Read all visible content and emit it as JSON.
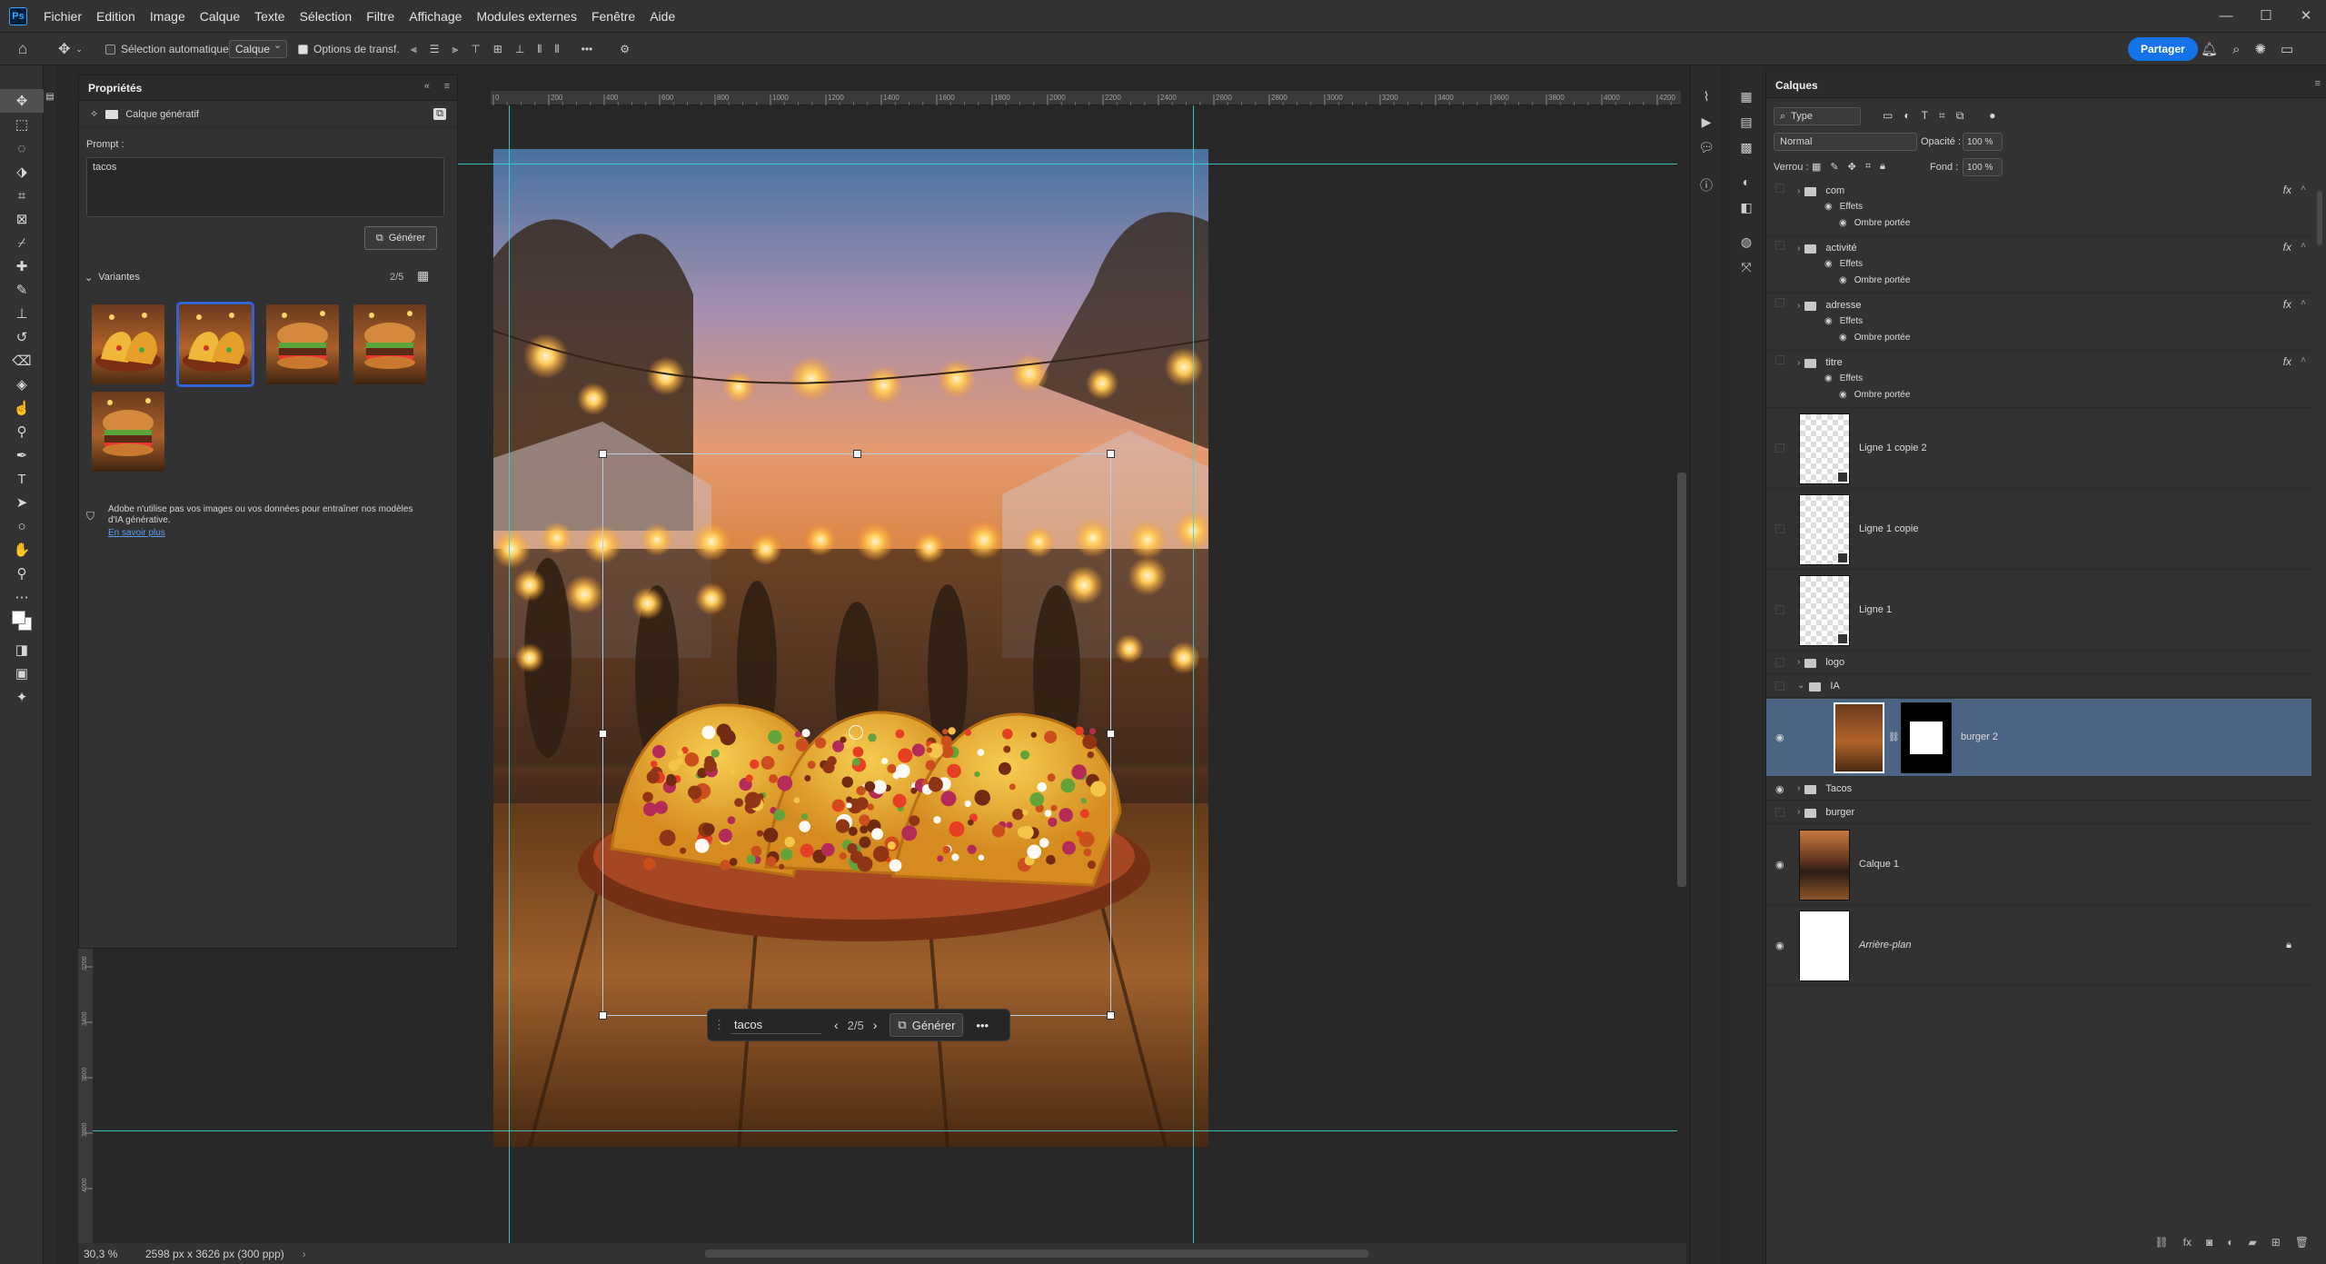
{
  "app": {
    "logo": "Ps"
  },
  "menu": [
    "Fichier",
    "Edition",
    "Image",
    "Calque",
    "Texte",
    "Sélection",
    "Filtre",
    "Affichage",
    "Modules externes",
    "Fenêtre",
    "Aide"
  ],
  "window_controls": {
    "minimize": "—",
    "maximize": "☐",
    "close": "✕"
  },
  "options_bar": {
    "auto_select_label": "Sélection automatique :",
    "auto_select_target": "Calque",
    "transform_options_label": "Options de transf.",
    "share_label": "Partager"
  },
  "properties": {
    "title": "Propriétés",
    "layer_type": "Calque génératif",
    "prompt_label": "Prompt :",
    "prompt_value": "tacos",
    "generate_label": "Générer",
    "variants_label": "Variantes",
    "variants_count": "2/5",
    "variants": [
      {
        "name": "tacos",
        "selected": false
      },
      {
        "name": "tacos",
        "selected": true
      },
      {
        "name": "burger",
        "selected": false
      },
      {
        "name": "burger",
        "selected": false
      },
      {
        "name": "burger",
        "selected": false
      }
    ],
    "disclaimer": "Adobe n'utilise pas vos images ou vos données pour entraîner nos modèles d'IA générative.",
    "learn_more": "En savoir plus"
  },
  "ruler": {
    "ticks": [
      "0",
      "200",
      "400",
      "600",
      "800",
      "1000",
      "1200",
      "1400",
      "1600",
      "1800",
      "2000",
      "2200",
      "2400",
      "2600",
      "2800",
      "3000",
      "3200",
      "3400",
      "3600",
      "3800",
      "4000",
      "4200"
    ],
    "vticks": [
      "3200",
      "3400",
      "3600",
      "3800",
      "4000"
    ]
  },
  "context_bar": {
    "prompt": "tacos",
    "count": "2/5",
    "generate_label": "Générer"
  },
  "status": {
    "zoom": "30,3 %",
    "doc_info": "2598 px x 3626 px (300 ppp)"
  },
  "layers_panel": {
    "title": "Calques",
    "filter_label": "Type",
    "blend_mode": "Normal",
    "opacity_label": "Opacité :",
    "opacity_value": "100 %",
    "lock_label": "Verrou :",
    "fill_label": "Fond :",
    "fill_value": "100 %",
    "fx_label": "fx",
    "effects_label": "Effets",
    "shadow_label": "Ombre portée",
    "groups_with_fx": [
      {
        "name": "com"
      },
      {
        "name": "activité"
      },
      {
        "name": "adresse"
      },
      {
        "name": "titre"
      }
    ],
    "layers": [
      {
        "name": "Ligne 1 copie 2",
        "visible": false
      },
      {
        "name": "Ligne 1 copie",
        "visible": false
      },
      {
        "name": "Ligne 1",
        "visible": false
      },
      {
        "name": "logo",
        "visible": false
      },
      {
        "name": "IA",
        "visible": false
      },
      {
        "name": "burger 2",
        "visible": true,
        "selected": true
      },
      {
        "name": "Tacos",
        "visible": true
      },
      {
        "name": "burger",
        "visible": false
      },
      {
        "name": "Calque 1",
        "visible": true
      },
      {
        "name": "Arrière-plan",
        "visible": true,
        "locked": true
      }
    ]
  },
  "colors": {
    "accent": "#1473e6",
    "guide": "#3ad7d0",
    "selected_layer": "#4b6484",
    "variant_selected": "#2f63d6"
  }
}
